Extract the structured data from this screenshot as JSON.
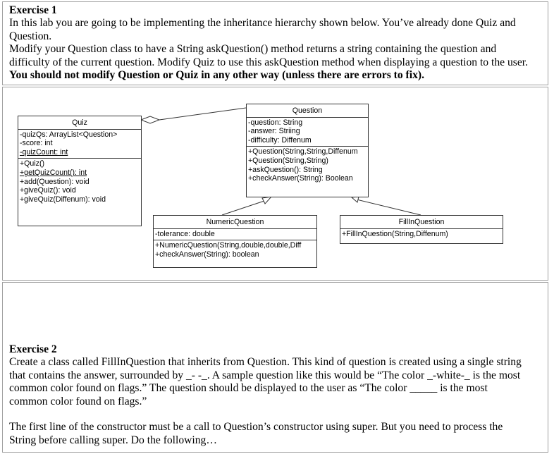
{
  "exercise1": {
    "title": "Exercise 1",
    "lines": [
      "In this lab you are going to be implementing the inheritance hierarchy shown below. You’ve already done Quiz and",
      "Question.",
      "Modify your Question class to have a String askQuestion() method returns a string containing the question and",
      "difficulty of the current question. Modify Quiz to use this askQuestion method when displaying a question to the user."
    ],
    "bold_line": "You should not modify Question or Quiz in any other way (unless there are errors to fix)."
  },
  "diagram": {
    "quiz": {
      "name": "Quiz",
      "attributes": [
        "-quizQs: ArrayList<Question>",
        "-score: int",
        "-quizCount: int"
      ],
      "methods": [
        "+Quiz()",
        "+getQuizCount(): int",
        "+add(Question): void",
        "+giveQuiz(): void",
        "+giveQuiz(Diffenum): void"
      ]
    },
    "question": {
      "name": "Question",
      "attributes": [
        "-question: String",
        "-answer: Striing",
        "-difficulty: Diffenum"
      ],
      "methods": [
        "+Question(String,String,Diffenum",
        "+Question(String,String)",
        "+askQuestion(): String",
        "+checkAnswer(String): Boolean"
      ]
    },
    "numeric": {
      "name": "NumericQuestion",
      "attributes": [
        "-tolerance: double"
      ],
      "methods": [
        "+NumericQuestion(String,double,double,Diff",
        "+checkAnswer(String): boolean"
      ]
    },
    "fillin": {
      "name": "FillInQuestion",
      "methods": [
        "+FillInQuestion(String,Diffenum)"
      ]
    }
  },
  "exercise2": {
    "title": "Exercise 2",
    "lines": [
      "Create a class called FillInQuestion that inherits from Question. This kind of question is created using a single string",
      "that contains the answer, surrounded by _-  -_.  A sample question like this would be “The color _-white-_ is the most",
      "common color found on flags.”  The question should be displayed to the user as “The color _____ is the most",
      "common color found on flags.”",
      "",
      "The first line of the constructor must be a call to Question’s constructor using super.  But you need to process the",
      "String before calling super. Do the following…"
    ]
  }
}
